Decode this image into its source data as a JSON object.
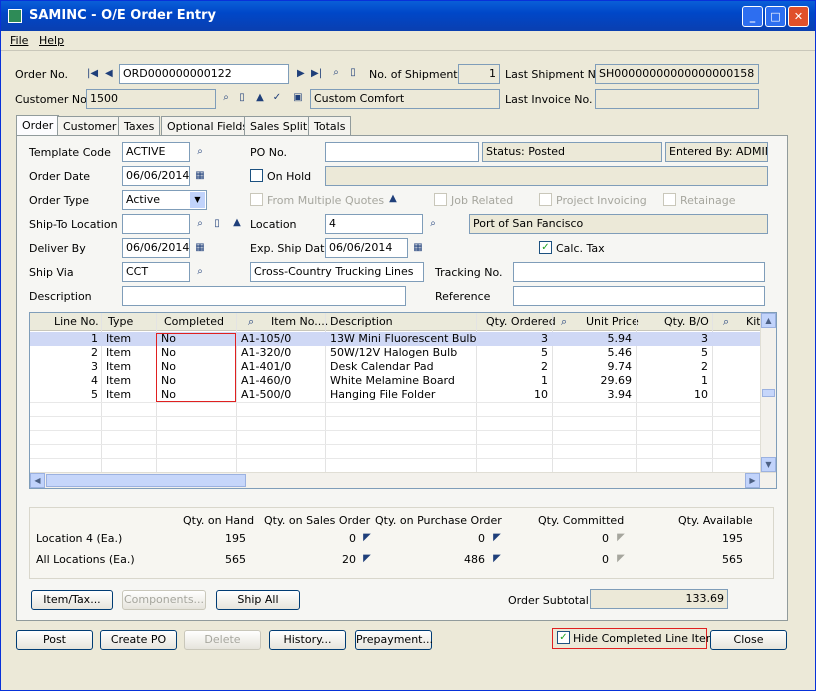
{
  "window": {
    "title": "SAMINC - O/E Order Entry"
  },
  "menu": [
    "File",
    "Help"
  ],
  "header": {
    "order_no_label": "Order No.",
    "order_no": "ORD000000000122",
    "no_shipments_label": "No. of Shipments",
    "no_shipments": "1",
    "last_shipment_label": "Last Shipment No.",
    "last_shipment": "SH00000000000000000158",
    "customer_no_label": "Customer No.",
    "customer_no": "1500",
    "customer_name": "Custom Comfort",
    "last_invoice_label": "Last Invoice No.",
    "last_invoice": ""
  },
  "tabs": [
    "Order",
    "Customer",
    "Taxes",
    "Optional Fields",
    "Sales Split",
    "Totals"
  ],
  "form": {
    "template_code_label": "Template Code",
    "template_code": "ACTIVE",
    "po_no_label": "PO No.",
    "po_no": "",
    "status": "Status: Posted",
    "entered_by": "Entered By: ADMIN",
    "order_date_label": "Order Date",
    "order_date": "06/06/2014",
    "on_hold_label": "On Hold",
    "on_hold_value": "",
    "order_type_label": "Order Type",
    "order_type": "Active",
    "from_quotes_label": "From Multiple Quotes",
    "job_related_label": "Job Related",
    "project_invoicing_label": "Project Invoicing",
    "retainage_label": "Retainage",
    "ship_to_label": "Ship-To Location",
    "ship_to": "",
    "location_label": "Location",
    "location": "4",
    "location_name": "Port of San Fancisco",
    "deliver_by_label": "Deliver By",
    "deliver_by": "06/06/2014",
    "exp_ship_label": "Exp. Ship Date",
    "exp_ship": "06/06/2014",
    "calc_tax_label": "Calc. Tax",
    "ship_via_label": "Ship Via",
    "ship_via": "CCT",
    "ship_via_name": "Cross-Country Trucking Lines",
    "tracking_label": "Tracking No.",
    "tracking": "",
    "description_label": "Description",
    "description": "",
    "reference_label": "Reference",
    "reference": ""
  },
  "grid": {
    "headers": [
      "Line No.",
      "Type",
      "Completed",
      "Item No....",
      "Description",
      "Qty. Ordered",
      "Unit Price",
      "Qty. B/O",
      "Kit"
    ],
    "rows": [
      [
        "1",
        "Item",
        "No",
        "A1-105/0",
        "13W Mini Fluorescent Bulb",
        "3",
        "5.94",
        "3"
      ],
      [
        "2",
        "Item",
        "No",
        "A1-320/0",
        "50W/12V Halogen Bulb",
        "5",
        "5.46",
        "5"
      ],
      [
        "3",
        "Item",
        "No",
        "A1-401/0",
        "Desk Calendar Pad",
        "2",
        "9.74",
        "2"
      ],
      [
        "4",
        "Item",
        "No",
        "A1-460/0",
        "White Melamine Board",
        "1",
        "29.69",
        "1"
      ],
      [
        "5",
        "Item",
        "No",
        "A1-500/0",
        "Hanging File Folder",
        "10",
        "3.94",
        "10"
      ]
    ]
  },
  "summary": {
    "headers": [
      "Qty. on Hand",
      "Qty. on Sales Order",
      "Qty. on Purchase Order",
      "Qty. Committed",
      "Qty. Available"
    ],
    "location_label": "Location  4 (Ea.)",
    "location_values": [
      "195",
      "0",
      "0",
      "0",
      "195"
    ],
    "all_label": "All Locations (Ea.)",
    "all_values": [
      "565",
      "20",
      "486",
      "0",
      "565"
    ]
  },
  "buttons": {
    "item_tax": "Item/Tax...",
    "components": "Components...",
    "ship_all": "Ship All",
    "order_subtotal_label": "Order Subtotal",
    "order_subtotal": "133.69",
    "post": "Post",
    "create_po": "Create PO",
    "delete": "Delete",
    "history": "History...",
    "prepayment": "Prepayment...",
    "hide_completed": "Hide Completed Line Items",
    "close": "Close"
  }
}
